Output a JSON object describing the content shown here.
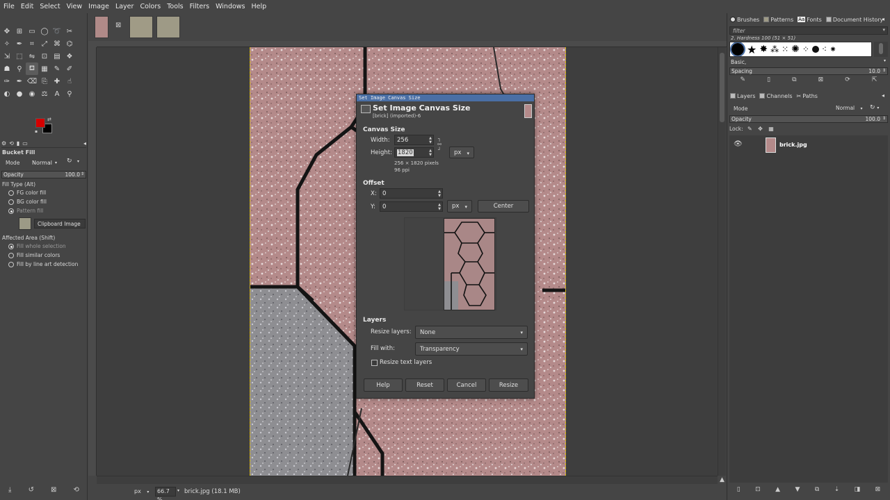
{
  "menu": [
    "File",
    "Edit",
    "Select",
    "View",
    "Image",
    "Layer",
    "Colors",
    "Tools",
    "Filters",
    "Windows",
    "Help"
  ],
  "colors": {
    "fg": "#d40000",
    "bg": "#000000",
    "accent": "#4a6fa5",
    "brick_red": "#b48a8a",
    "brick_gray": "#8e8e92"
  },
  "toolbox": {
    "tool_options_title": "Bucket Fill",
    "mode_label": "Mode",
    "mode_value": "Normal",
    "opacity_label": "Opacity",
    "opacity_value": "100.0",
    "fill_type_label": "Fill Type  (Alt)",
    "fill_types": [
      "FG color fill",
      "BG color fill",
      "Pattern fill"
    ],
    "pattern_name": "Clipboard Image",
    "affected_label": "Affected Area  (Shift)",
    "affected_options": [
      "Fill whole selection",
      "Fill similar colors",
      "Fill by line art detection"
    ]
  },
  "status": {
    "unit": "px",
    "zoom": "66.7 %",
    "info": "brick.jpg (18.1 MB)"
  },
  "right_panel": {
    "tabs": [
      "Brushes",
      "Patterns",
      "Fonts",
      "Document History"
    ],
    "filter_placeholder": "filter",
    "brush_name": "2. Hardness 100 (51 × 51)",
    "brush_tag": "Basic,",
    "spacing_label": "Spacing",
    "spacing_value": "10.0",
    "layer_tabs": [
      "Layers",
      "Channels",
      "Paths"
    ],
    "mode_label": "Mode",
    "mode_value": "Normal",
    "opacity_label": "Opacity",
    "opacity_value": "100.0",
    "lock_label": "Lock:",
    "layer_name": "brick.jpg"
  },
  "dialog": {
    "window_title": "Set Image Canvas Size",
    "title": "Set Image Canvas Size",
    "subtitle": "[brick] (imported)-6",
    "canvas_size_label": "Canvas Size",
    "width_label": "Width:",
    "width_value": "256",
    "height_label": "Height:",
    "height_value": "1820",
    "size_info": "256 × 1820 pixels",
    "ppi_info": "96 ppi",
    "unit": "px",
    "offset_label": "Offset",
    "x_label": "X:",
    "x_value": "0",
    "y_label": "Y:",
    "y_value": "0",
    "offset_unit": "px",
    "center_button": "Center",
    "layers_label": "Layers",
    "resize_layers_label": "Resize layers:",
    "resize_layers_value": "None",
    "fill_with_label": "Fill with:",
    "fill_with_value": "Transparency",
    "resize_text_label": "Resize text layers",
    "buttons": [
      "Help",
      "Reset",
      "Cancel",
      "Resize"
    ]
  }
}
